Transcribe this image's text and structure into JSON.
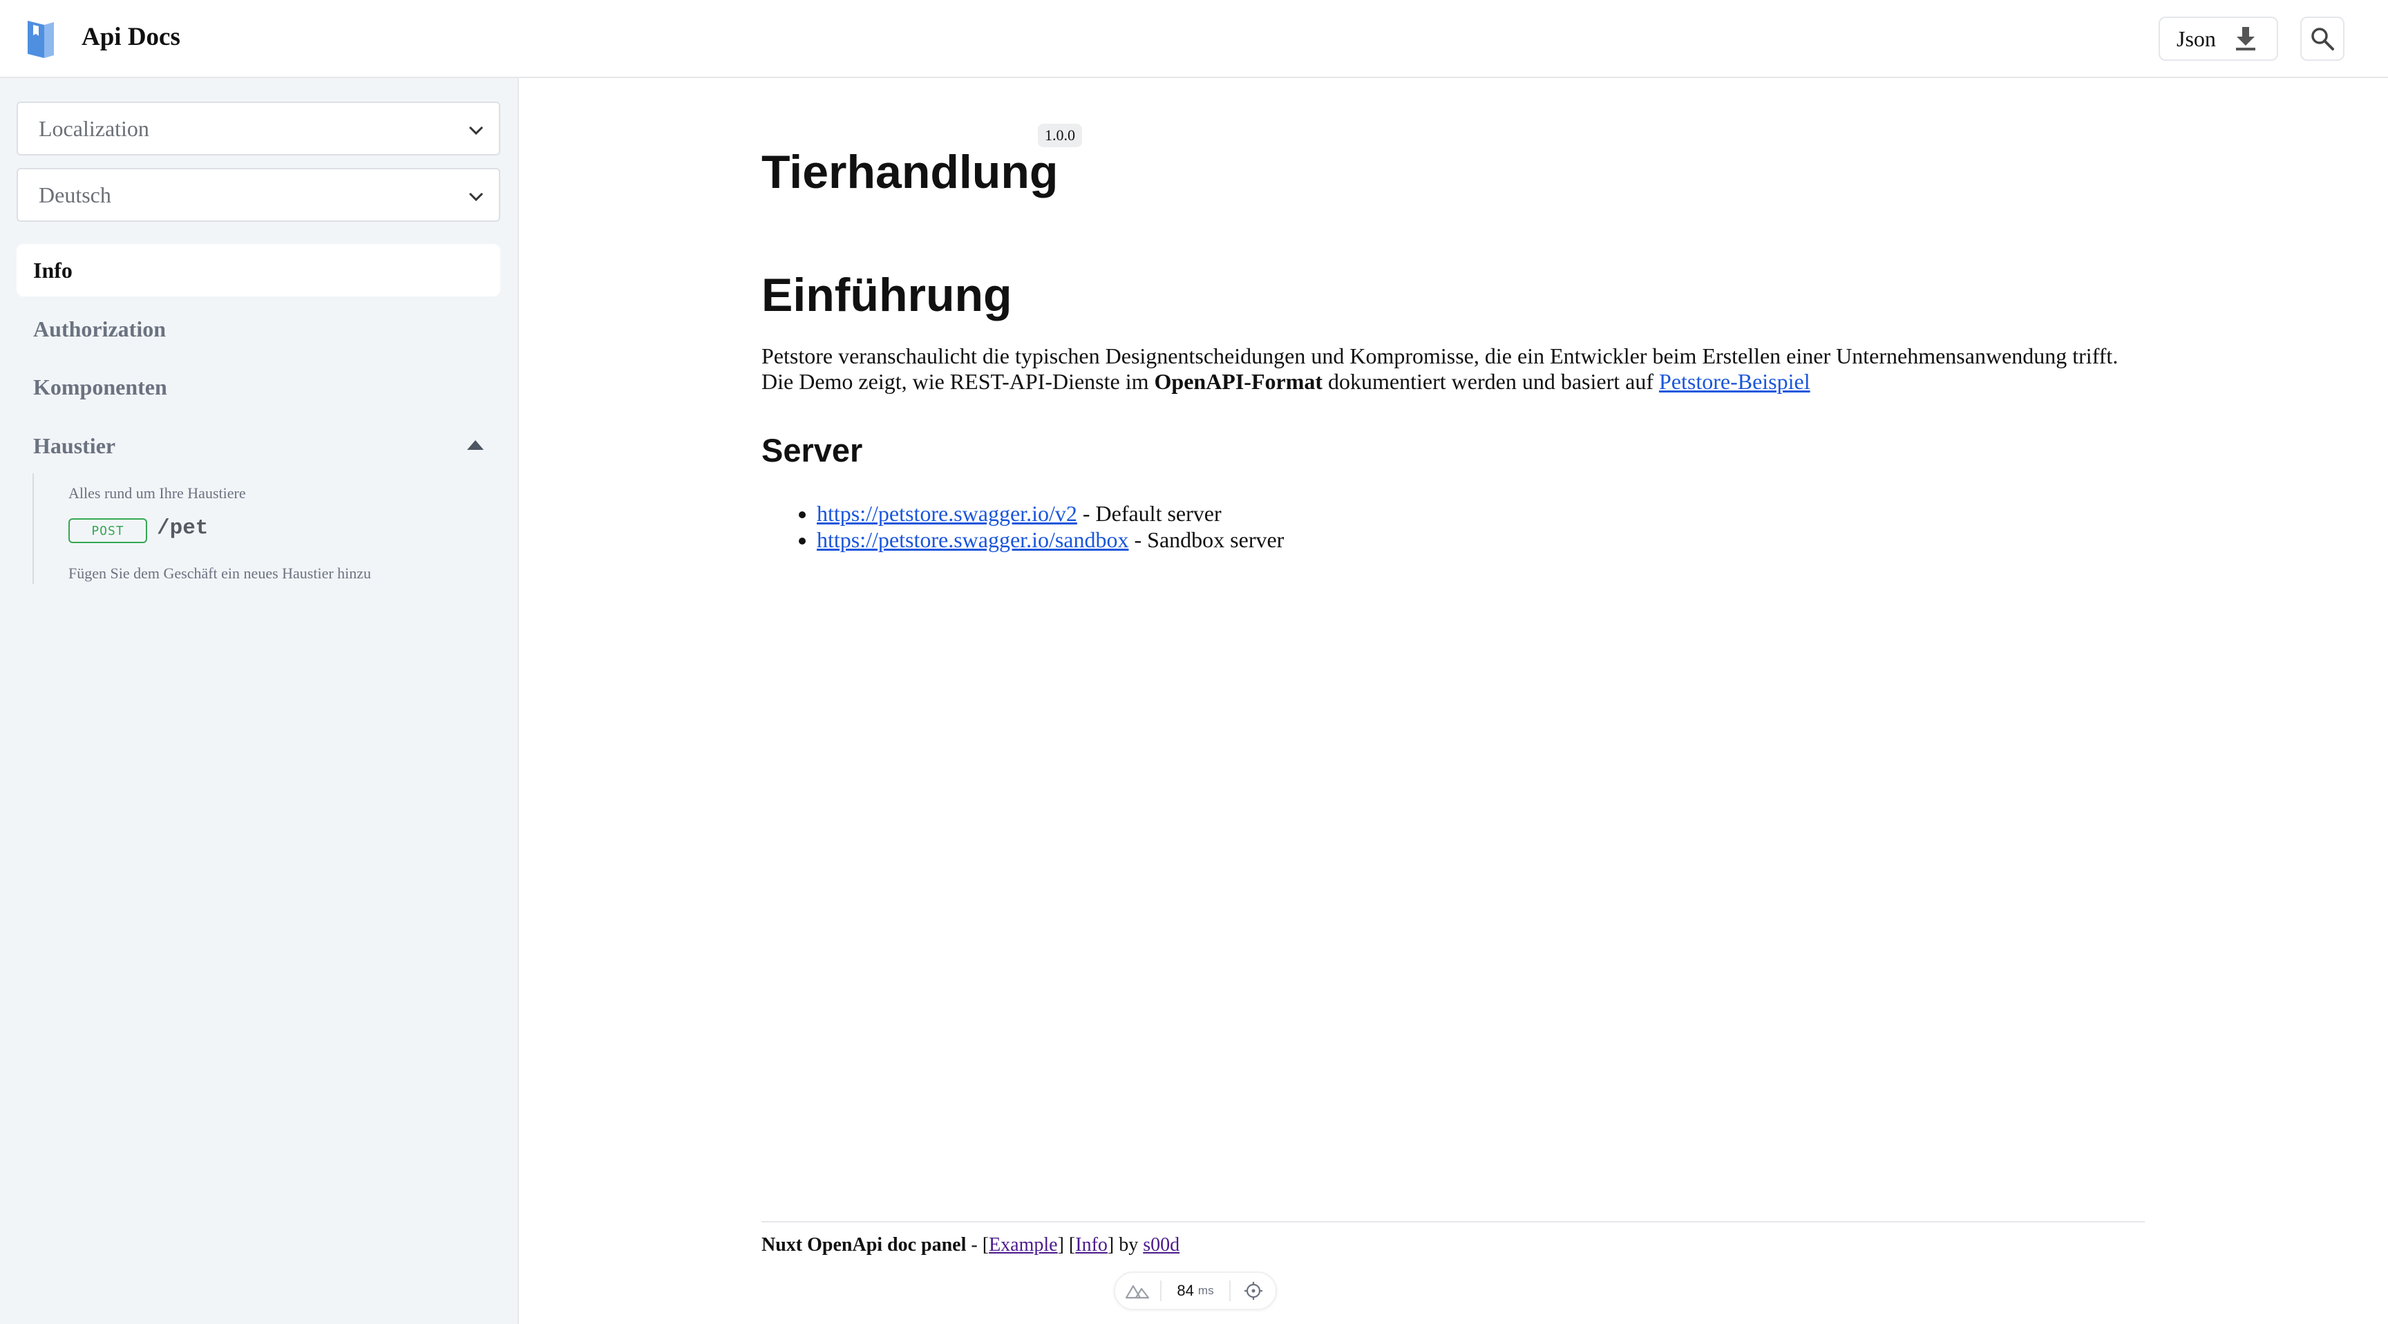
{
  "app": {
    "title": "Api Docs"
  },
  "header": {
    "json_label": "Json"
  },
  "sidebar": {
    "localization_select": "Localization",
    "language_select": "Deutsch",
    "nav": [
      {
        "label": "Info",
        "active": true
      },
      {
        "label": "Authorization",
        "active": false
      },
      {
        "label": "Komponenten",
        "active": false
      },
      {
        "label": "Haustier",
        "active": false,
        "expanded": true
      }
    ],
    "group": {
      "description": "Alles rund um Ihre Haustiere",
      "endpoint": {
        "method": "POST",
        "path": "/pet",
        "summary": "Fügen Sie dem Geschäft ein neues Haustier hinzu"
      }
    }
  },
  "main": {
    "version": "1.0.0",
    "title": "Tierhandlung",
    "intro_heading": "Einführung",
    "intro_line1": "Petstore veranschaulicht die typischen Designentscheidungen und Kompromisse, die ein Entwickler beim Erstellen einer Unternehmensanwendung trifft.",
    "intro_line2_a": "Die Demo zeigt, wie REST-API-Dienste im ",
    "intro_line2_bold": "OpenAPI-Format",
    "intro_line2_b": " dokumentiert werden und basiert auf ",
    "intro_link": "Petstore-Beispiel",
    "servers_heading": "Server",
    "servers": [
      {
        "url": "https://petstore.swagger.io/v2",
        "desc": " - Default server"
      },
      {
        "url": "https://petstore.swagger.io/sandbox",
        "desc": " - Sandbox server"
      }
    ]
  },
  "footer": {
    "brand": "Nuxt OpenApi doc panel",
    "sep1": " - [",
    "link_example": "Example",
    "sep2": "] [",
    "link_info": "Info",
    "sep3": "] by ",
    "link_author": "s00d"
  },
  "devtools": {
    "time_value": "84",
    "time_unit": "ms"
  },
  "colors": {
    "accent_link": "#1a56db",
    "post_method": "#34a853",
    "sidebar_bg": "#f2f5f8"
  }
}
